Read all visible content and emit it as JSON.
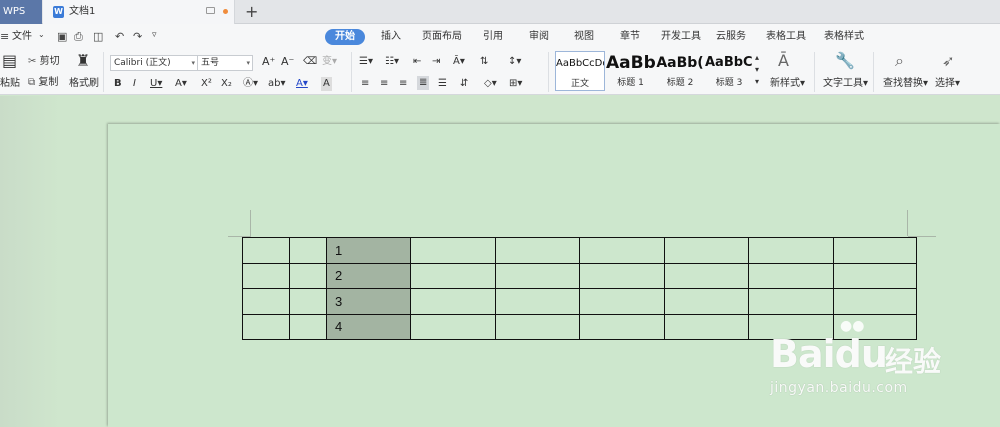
{
  "app": {
    "name": "WPS"
  },
  "tabs": {
    "document_title": "文档1",
    "new_tab": "+"
  },
  "quick": {
    "file_menu": "文件"
  },
  "menu": {
    "start": "开始",
    "insert": "插入",
    "page_layout": "页面布局",
    "reference": "引用",
    "review": "审阅",
    "view": "视图",
    "chapter": "章节",
    "developer": "开发工具",
    "cloud": "云服务",
    "table_tools": "表格工具",
    "table_style": "表格样式"
  },
  "clipboard": {
    "paste": "粘贴",
    "cut": "剪切",
    "copy": "复制",
    "format_painter": "格式刷"
  },
  "font": {
    "name": "Calibri (正文)",
    "size": "五号"
  },
  "styles": [
    {
      "sample": "AaBbCcDd",
      "name": "正文"
    },
    {
      "sample": "AaBb",
      "name": "标题 1"
    },
    {
      "sample": "AaBb(",
      "name": "标题 2"
    },
    {
      "sample": "AaBbC(",
      "name": "标题 3"
    }
  ],
  "tools": {
    "new_style": "新样式",
    "text_tools": "文字工具",
    "find_replace": "查找替换",
    "select": "选择"
  },
  "table": {
    "rows": [
      [
        "",
        "",
        "1",
        "",
        "",
        "",
        "",
        "",
        ""
      ],
      [
        "",
        "",
        "2",
        "",
        "",
        "",
        "",
        "",
        ""
      ],
      [
        "",
        "",
        "3",
        "",
        "",
        "",
        "",
        "",
        ""
      ],
      [
        "",
        "",
        "4",
        "",
        "",
        "",
        "",
        "",
        ""
      ]
    ],
    "selected_column": 2
  },
  "watermark": {
    "brand": "Bai",
    "brand_tail": "du",
    "cn": "经验",
    "url": "jingyan.baidu.com"
  },
  "colors": {
    "accent": "#4a88dc",
    "page_bg": "#cde7cd",
    "selection": "#a3b4a2"
  }
}
